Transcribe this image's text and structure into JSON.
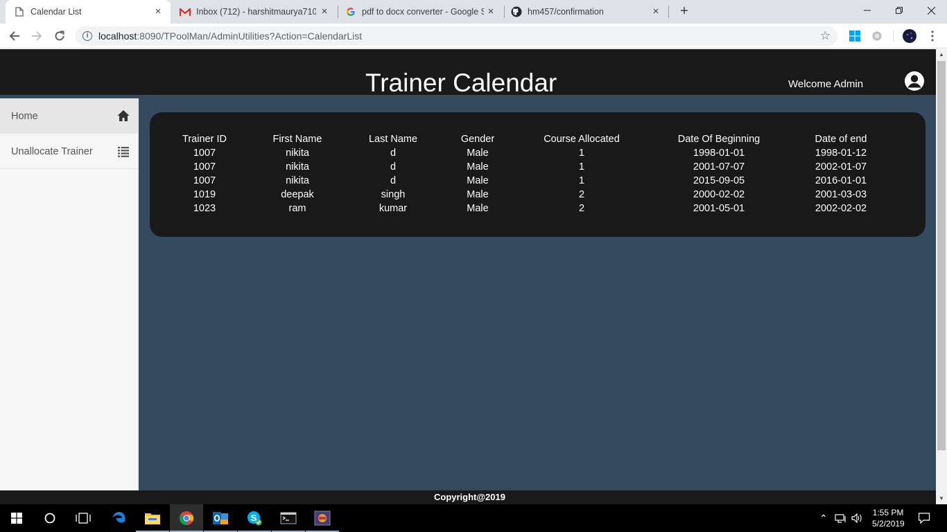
{
  "browser": {
    "tabs": [
      {
        "title": "Calendar List",
        "icon": "document-icon",
        "active": true
      },
      {
        "title": "Inbox (712) - harshitmaurya710@",
        "icon": "gmail-icon",
        "active": false
      },
      {
        "title": "pdf to docx converter - Google S",
        "icon": "google-icon",
        "active": false
      },
      {
        "title": "hm457/confirmation",
        "icon": "github-icon",
        "active": false
      }
    ],
    "close_glyph": "×",
    "new_tab_glyph": "+",
    "url_host": "localhost",
    "url_rest": ":8090/TPoolMan/AdminUtilities?Action=CalendarList"
  },
  "header": {
    "title": "Trainer Calendar",
    "welcome": "Welcome Admin"
  },
  "sidebar": {
    "items": [
      {
        "label": "Home",
        "icon": "home-icon"
      },
      {
        "label": "Unallocate Trainer",
        "icon": "list-icon"
      }
    ]
  },
  "table": {
    "columns": [
      "Trainer ID",
      "First Name",
      "Last Name",
      "Gender",
      "Course Allocated",
      "Date Of Beginning",
      "Date of end"
    ],
    "rows": [
      [
        "1007",
        "nikita",
        "d",
        "Male",
        "1",
        "1998-01-01",
        "1998-01-12"
      ],
      [
        "1007",
        "nikita",
        "d",
        "Male",
        "1",
        "2001-07-07",
        "2002-01-07"
      ],
      [
        "1007",
        "nikita",
        "d",
        "Male",
        "1",
        "2015-09-05",
        "2016-01-01"
      ],
      [
        "1019",
        "deepak",
        "singh",
        "Male",
        "2",
        "2000-02-02",
        "2001-03-03"
      ],
      [
        "1023",
        "ram",
        "kumar",
        "Male",
        "2",
        "2001-05-01",
        "2002-02-02"
      ]
    ]
  },
  "footer": {
    "text": "Copyright@2019"
  },
  "taskbar": {
    "time": "1:55 PM",
    "date": "5/2/2019"
  },
  "colors": {
    "page_bg": "#344a5f",
    "header_bg": "#191919",
    "card_bg": "#191919",
    "sidebar_bg": "#f6f6f6"
  }
}
